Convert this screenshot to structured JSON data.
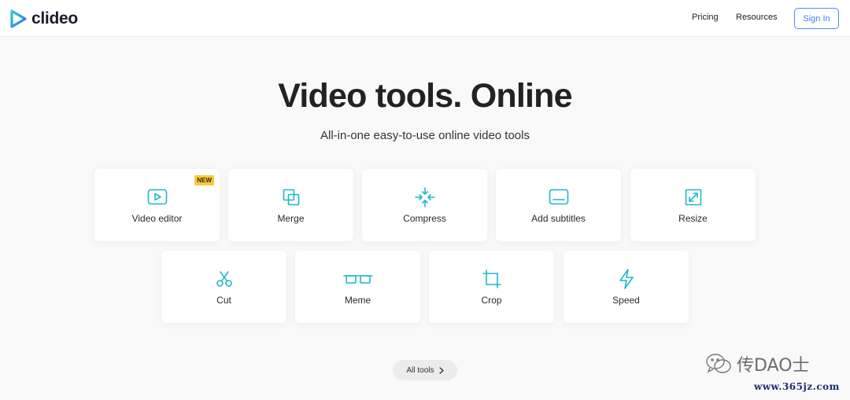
{
  "header": {
    "brand": "clideo",
    "nav": {
      "pricing": "Pricing",
      "resources": "Resources"
    },
    "sign_in": "Sign In"
  },
  "hero": {
    "title": "Video tools. Online",
    "subtitle": "All-in-one easy-to-use online video tools"
  },
  "tools": [
    {
      "label": "Video editor",
      "icon": "video-play-icon",
      "badge": "NEW"
    },
    {
      "label": "Merge",
      "icon": "merge-icon"
    },
    {
      "label": "Compress",
      "icon": "compress-icon"
    },
    {
      "label": "Add subtitles",
      "icon": "subtitles-icon"
    },
    {
      "label": "Resize",
      "icon": "resize-icon"
    },
    {
      "label": "Cut",
      "icon": "scissors-icon"
    },
    {
      "label": "Meme",
      "icon": "meme-glasses-icon"
    },
    {
      "label": "Crop",
      "icon": "crop-icon"
    },
    {
      "label": "Speed",
      "icon": "lightning-icon"
    }
  ],
  "all_tools": "All tools",
  "watermark": {
    "text": "传DAO士",
    "url": "www.365jz.com"
  },
  "colors": {
    "accent": "#1fb8c8",
    "sign_in": "#3b82f6",
    "badge": "#f8c93b"
  }
}
